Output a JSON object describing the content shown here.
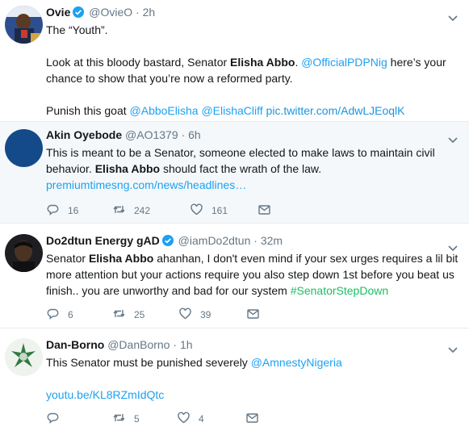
{
  "tweets": [
    {
      "name": "Ovie",
      "handle": "@OvieO",
      "dot": "·",
      "time": "2h",
      "p1": "The “Youth”.",
      "p2a": "Look at this bloody bastard, Senator ",
      "p2b": "Elisha Abbo",
      "p2c": ". ",
      "p2link": "@OfficialPDPNig",
      "p2d": " here’s your chance to show that you’re now a reformed party.",
      "p3a": "Punish this goat ",
      "p3m1": "@AbboElisha",
      "p3m2": "@ElishaCliff",
      "p3pic": "pic.twitter.com/AdwLJEoqlK"
    },
    {
      "name": "Akin Oyebode",
      "handle": "@AO1379",
      "dot": "·",
      "time": "6h",
      "t1": "This is meant to be a Senator, someone elected to make laws to maintain civil behavior. ",
      "t2": "Elisha Abbo",
      "t3": " should fact the wrath of the law.",
      "link": "premiumtimesng.com/news/headlines…",
      "replies": "16",
      "retweets": "242",
      "likes": "161"
    },
    {
      "name": "Do2dtun Energy gAD",
      "handle": "@iamDo2dtun",
      "dot": "·",
      "time": "32m",
      "t1": "Senator ",
      "t2": "Elisha Abbo",
      "t3": " ahanhan, I don't even mind if your sex urges requires a lil bit more attention but your actions require you also step down 1st before you beat us finish.. you are unworthy and bad for our system ",
      "hashtag": "#SenatorStepDown",
      "replies": "6",
      "retweets": "25",
      "likes": "39"
    },
    {
      "name": "Dan-Borno",
      "handle": "@DanBorno",
      "dot": "·",
      "time": "1h",
      "t1": "This Senator must be punished severely ",
      "mention": "@AmnestyNigeria",
      "link": "youtu.be/KL8RZmIdQtc",
      "replies": "",
      "retweets": "5",
      "likes": "4"
    }
  ],
  "icons": {
    "verified": "verified-badge-icon",
    "caret": "chevron-down-icon",
    "reply": "reply-icon",
    "retweet": "retweet-icon",
    "like": "heart-icon",
    "dm": "envelope-icon"
  },
  "colors": {
    "link": "#1da1f2",
    "hashtag": "#17bf63",
    "muted": "#657786",
    "text": "#14171a"
  }
}
